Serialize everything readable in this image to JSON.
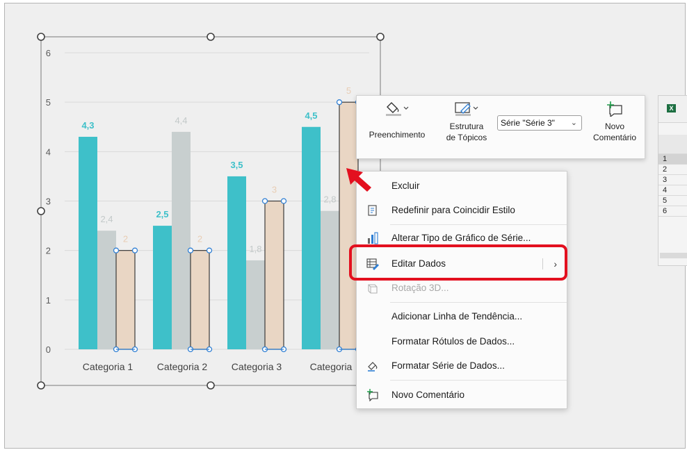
{
  "chart_data": {
    "type": "bar",
    "categories": [
      "Categoria 1",
      "Categoria 2",
      "Categoria 3",
      "Categoria"
    ],
    "series": [
      {
        "values": [
          4.3,
          2.5,
          3.5,
          4.5
        ],
        "color": "#3ec0c9",
        "labels": [
          "4,3",
          "2,5",
          "3,5",
          "4,5"
        ]
      },
      {
        "values": [
          2.4,
          4.4,
          1.8,
          2.8
        ],
        "color": "#c8cfcf",
        "labels": [
          "2,4",
          "4,4",
          "1,8",
          "2,8"
        ]
      },
      {
        "values": [
          2,
          2,
          3,
          5
        ],
        "color": "#e9d6c4",
        "labels": [
          "2",
          "2",
          "3",
          "5"
        ]
      }
    ],
    "ylim": [
      0,
      6
    ],
    "yticks": [
      "0",
      "1",
      "2",
      "3",
      "4",
      "5",
      "6"
    ],
    "grid": true,
    "selected_series": 2
  },
  "toolbar": {
    "fill_label": "Preenchimento",
    "outline_label_1": "Estrutura",
    "outline_label_2": "de Tópicos",
    "series_select": "Série \"Série 3\"",
    "new_comment_1": "Novo",
    "new_comment_2": "Comentário"
  },
  "menu": {
    "delete": "Excluir",
    "reset_style": "Redefinir para Coincidir Estilo",
    "change_type": "Alterar Tipo de Gráfico de Série...",
    "edit_data": "Editar Dados",
    "rotation": "Rotação 3D...",
    "trendline": "Adicionar Linha de Tendência...",
    "format_labels": "Formatar Rótulos de Dados...",
    "format_series": "Formatar Série de Dados...",
    "new_comment": "Novo Comentário"
  },
  "excel": {
    "logo": "X",
    "rows": [
      "1",
      "2",
      "3",
      "4",
      "5",
      "6"
    ]
  },
  "colors": {
    "highlight": "#e3101f",
    "pointer": "#e3101f",
    "selection": "#2f7fd4"
  }
}
